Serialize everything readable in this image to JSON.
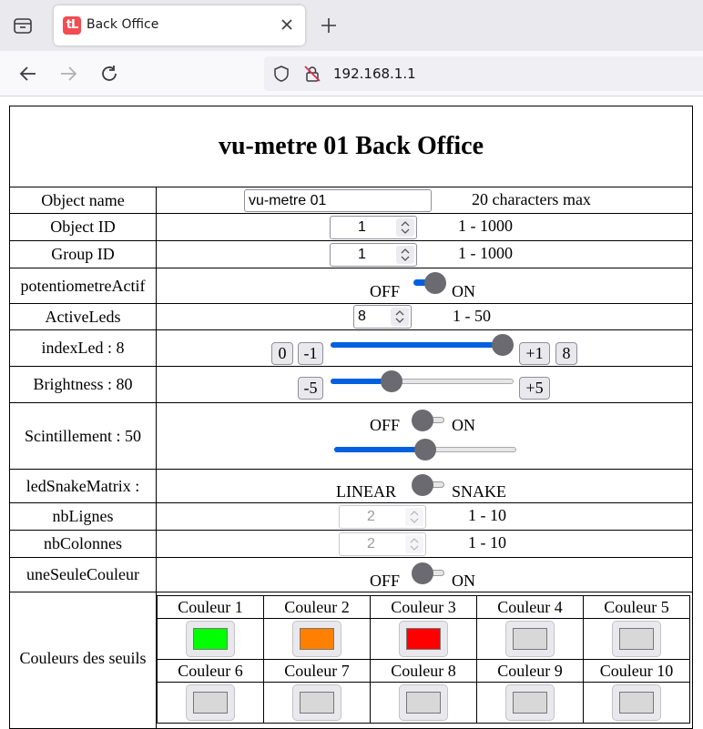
{
  "browser": {
    "tab_title": "Back Office",
    "favicon_text": "tL",
    "url": "192.168.1.1"
  },
  "page": {
    "title": "vu-metre 01 Back Office",
    "object_name": {
      "label": "Object name",
      "value": "vu-metre 01",
      "hint": "20 characters max"
    },
    "object_id": {
      "label": "Object ID",
      "value": "1",
      "range": "1 - 1000"
    },
    "group_id": {
      "label": "Group ID",
      "value": "1",
      "range": "1 - 1000"
    },
    "potentiometre": {
      "label": "potentiometreActif",
      "off": "OFF",
      "on": "ON",
      "state": "on"
    },
    "active_leds": {
      "label": "ActiveLeds",
      "value": "8",
      "range": "1 - 50"
    },
    "index_led": {
      "label": "indexLed : 8",
      "btn_zero": "0",
      "btn_minus": "-1",
      "btn_plus": "+1",
      "btn_max": "8",
      "level": 1.0
    },
    "brightness": {
      "label": "Brightness : 80",
      "btn_minus": "-5",
      "btn_plus": "+5",
      "level": 0.31
    },
    "scintillement": {
      "label": "Scintillement : 50",
      "off": "OFF",
      "on": "ON",
      "state": "off",
      "level": 0.5
    },
    "led_snake": {
      "label": "ledSnakeMatrix :",
      "off": "LINEAR",
      "on": "SNAKE",
      "state": "off"
    },
    "nb_lignes": {
      "label": "nbLignes",
      "value": "2",
      "range": "1 - 10"
    },
    "nb_colonnes": {
      "label": "nbColonnes",
      "value": "2",
      "range": "1 - 10"
    },
    "une_seule": {
      "label": "uneSeuleCouleur",
      "off": "OFF",
      "on": "ON",
      "state": "off"
    },
    "couleurs": {
      "label": "Couleurs des seuils",
      "row1": [
        {
          "name": "Couleur 1",
          "color": "#00ff00"
        },
        {
          "name": "Couleur 2",
          "color": "#ff8000"
        },
        {
          "name": "Couleur 3",
          "color": "#ff0000"
        },
        {
          "name": "Couleur 4",
          "color": "#d8d8d8"
        },
        {
          "name": "Couleur 5",
          "color": "#d8d8d8"
        }
      ],
      "row2": [
        {
          "name": "Couleur 6",
          "color": "#d8d8d8"
        },
        {
          "name": "Couleur 7",
          "color": "#d8d8d8"
        },
        {
          "name": "Couleur 8",
          "color": "#d8d8d8"
        },
        {
          "name": "Couleur 9",
          "color": "#d8d8d8"
        },
        {
          "name": "Couleur 10",
          "color": "#d8d8d8"
        }
      ]
    }
  }
}
